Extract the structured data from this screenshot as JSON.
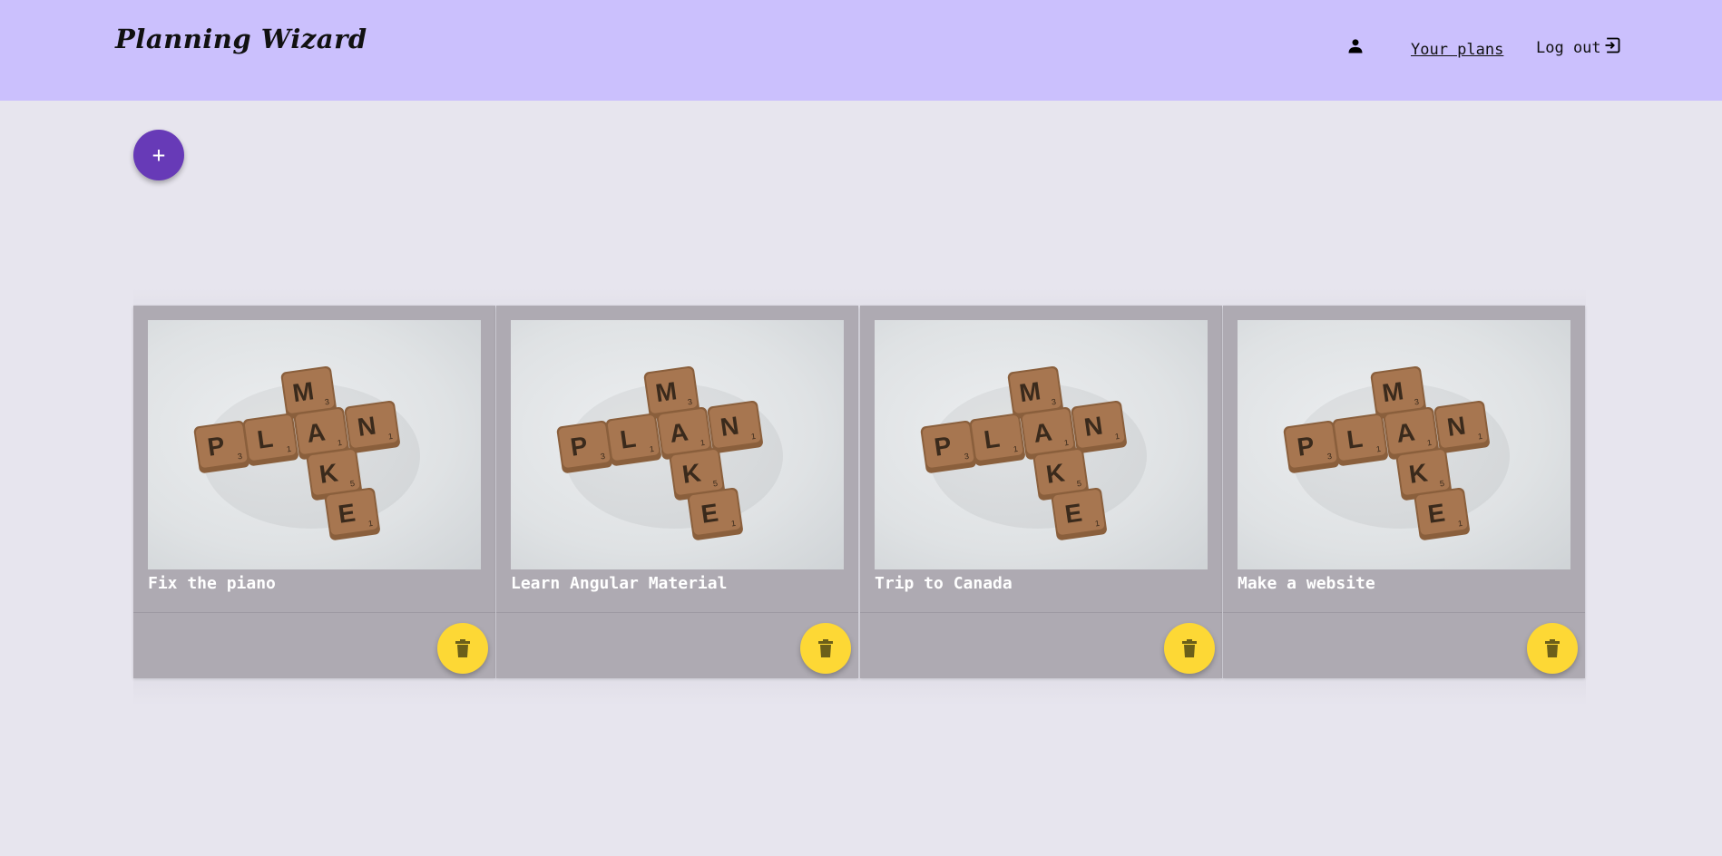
{
  "header": {
    "brand": "Planning Wizard",
    "nav": {
      "user_icon": "person-icon",
      "plans_label": "Your plans",
      "logout_label": "Log out",
      "logout_icon": "logout-icon"
    }
  },
  "actions": {
    "add_icon": "plus-icon",
    "add_label": "+"
  },
  "plans": [
    {
      "title": "Fix the piano",
      "image": "scrabble-tiles-plan-make"
    },
    {
      "title": "Learn Angular Material",
      "image": "scrabble-tiles-plan-make"
    },
    {
      "title": "Trip to Canada",
      "image": "scrabble-tiles-plan-make"
    },
    {
      "title": "Make a website",
      "image": "scrabble-tiles-plan-make"
    }
  ],
  "colors": {
    "header_bg": "#cbc0fd",
    "page_bg": "#e7e5ee",
    "add_button": "#673ab7",
    "delete_button": "#fdd835",
    "card_bg": "#aeaab2"
  }
}
